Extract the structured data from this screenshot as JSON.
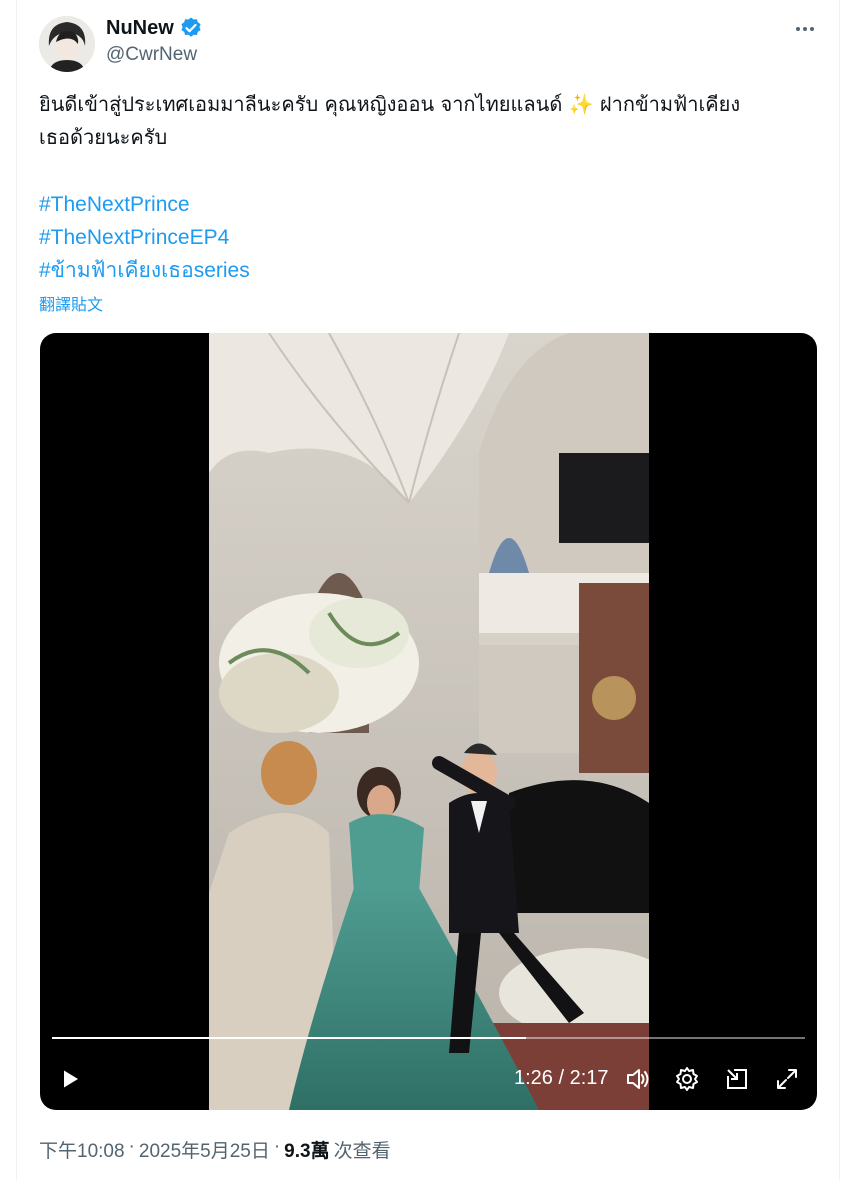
{
  "author": {
    "display_name": "NuNew",
    "handle": "@CwrNew",
    "verified": true
  },
  "post": {
    "line1": "ยินดีเข้าสู่ประเทศเอมมาลีนะครับ คุณหญิงออน จากไทยแลนด์ ✨ ฝากข้ามฟ้าเคียง",
    "line2": "เธอด้วยนะครับ",
    "hashtags": [
      "#TheNextPrince",
      "#TheNextPrinceEP4",
      "#ข้ามฟ้าเคียงเธอseries"
    ],
    "translate_label": "翻譯貼文"
  },
  "video": {
    "current_time": "1:26",
    "duration": "2:17",
    "time_display": "1:26 / 2:17",
    "progress_fraction": 0.63
  },
  "meta": {
    "time": "下午10:08",
    "separator1": "·",
    "date": "2025年5月25日",
    "separator2": "·",
    "views_count": "9.3萬",
    "views_label": "次查看"
  },
  "colors": {
    "link": "#1d9bf0",
    "secondary_text": "#536471",
    "primary_text": "#0f1419",
    "verified_badge": "#1d9bf0"
  },
  "icons": [
    "more-icon",
    "verified-badge-icon",
    "play-icon",
    "volume-icon",
    "settings-icon",
    "pip-icon",
    "fullscreen-icon"
  ]
}
